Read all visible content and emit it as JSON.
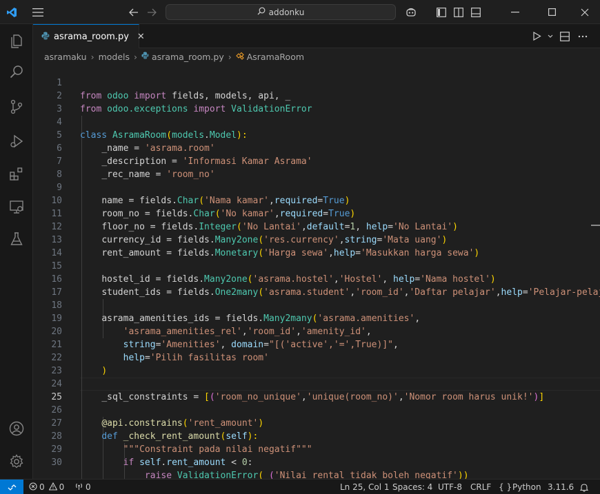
{
  "window": {
    "search_text": "addonku"
  },
  "tab": {
    "label": "asrama_room.py",
    "close_glyph": "✕"
  },
  "breadcrumb": {
    "items": [
      "asramaku",
      "models",
      "asrama_room.py",
      "AsramaRoom"
    ]
  },
  "editor": {
    "current_line": 25,
    "line_numbers": [
      "1",
      "2",
      "3",
      "4",
      "5",
      "6",
      "7",
      "8",
      "9",
      "10",
      "11",
      "12",
      "13",
      "14",
      "15",
      "16",
      "17",
      "18",
      "19",
      "20",
      "21",
      "22",
      "23",
      "24",
      "25",
      "26",
      "27",
      "28",
      "29",
      "30"
    ]
  },
  "code": {
    "l1": [
      "from",
      "odoo",
      "import",
      "fields, models, api, _"
    ],
    "l2": [
      "from",
      "odoo.exceptions",
      "import",
      "ValidationError"
    ],
    "l4": [
      "class",
      "AsramaRoom",
      "(",
      "models",
      ".",
      "Model",
      "):"
    ],
    "l5": [
      "_name = ",
      "'asrama.room'"
    ],
    "l6": [
      "_description = ",
      "'Informasi Kamar Asrama'"
    ],
    "l7": [
      "_rec_name = ",
      "'room_no'"
    ],
    "l9": [
      "name",
      " = fields.",
      "Char",
      "(",
      "'Nama kamar'",
      ",",
      "required",
      "=",
      "True",
      ")"
    ],
    "l10": [
      "room_no",
      " = fields.",
      "Char",
      "(",
      "'No kamar'",
      ",",
      "required",
      "=",
      "True",
      ")"
    ],
    "l11": [
      "floor_no",
      " = fields.",
      "Integer",
      "(",
      "'No Lantai'",
      ",",
      "default",
      "=",
      "1",
      ", ",
      "help",
      "=",
      "'No Lantai'",
      ")"
    ],
    "l12": [
      "currency_id",
      " = fields.",
      "Many2one",
      "(",
      "'res.currency'",
      ",",
      "string",
      "=",
      "'Mata uang'",
      ")"
    ],
    "l13": [
      "rent_amount",
      " = fields.",
      "Monetary",
      "(",
      "'Harga sewa'",
      ",",
      "help",
      "=",
      "'Masukkan harga sewa'",
      ")"
    ],
    "l15": [
      "hostel_id",
      " = fields.",
      "Many2one",
      "(",
      "'asrama.hostel'",
      ",",
      "'Hostel'",
      ", ",
      "help",
      "=",
      "'Nama hostel'",
      ")"
    ],
    "l16": [
      "student_ids",
      " = fields.",
      "One2many",
      "(",
      "'asrama.student'",
      ",",
      "'room_id'",
      ",",
      "'Daftar pelajar'",
      ",",
      "help",
      "=",
      "'Pelajar-pelaja"
    ],
    "l18": [
      "asrama_amenities_ids",
      " = fields.",
      "Many2many",
      "(",
      "'asrama.amenities'",
      ","
    ],
    "l19": [
      "'asrama_amenities_rel'",
      ",",
      "'room_id'",
      ",",
      "'amenity_id'",
      ","
    ],
    "l20": [
      "string",
      "=",
      "'Amenities'",
      ", ",
      "domain",
      "=",
      "\"[('active','=',True)]\"",
      ","
    ],
    "l21": [
      "help",
      "=",
      "'Pilih fasilitas room'"
    ],
    "l22": [
      ")"
    ],
    "l24": [
      "_sql_constraints",
      " = ",
      "[",
      "(",
      "'room_no_unique'",
      ",",
      "'unique(room_no)'",
      ",",
      "'Nomor room harus unik!'",
      ")",
      "]"
    ],
    "l26": [
      "@api.",
      "constrains",
      "(",
      "'rent_amount'",
      ")"
    ],
    "l27": [
      "def",
      "_check_rent_amount",
      "(",
      "self",
      "):"
    ],
    "l28": [
      "\"\"\"Constraint pada nilai negatif\"\"\""
    ],
    "l29": [
      "if",
      "self",
      ".",
      "rent_amount",
      " < ",
      "0",
      ":"
    ],
    "l30": [
      "raise",
      "ValidationError",
      "(",
      "_",
      "(",
      "'Nilai rental tidak boleh negatif'",
      "))"
    ]
  },
  "statusbar": {
    "errors": "0",
    "warnings": "0",
    "ports": "0",
    "position": "Ln 25, Col 1",
    "spaces": "Spaces: 4",
    "encoding": "UTF-8",
    "eol": "CRLF",
    "braces": "{ }",
    "language": "Python",
    "version": "3.11.6"
  },
  "colors": {
    "accent": "#0078d4",
    "keyword": "#569cd6",
    "control": "#c586c0",
    "class": "#4ec9b0",
    "function": "#dcdcaa",
    "string": "#ce9178",
    "variable": "#9cdcfe",
    "number": "#b5cea8"
  }
}
